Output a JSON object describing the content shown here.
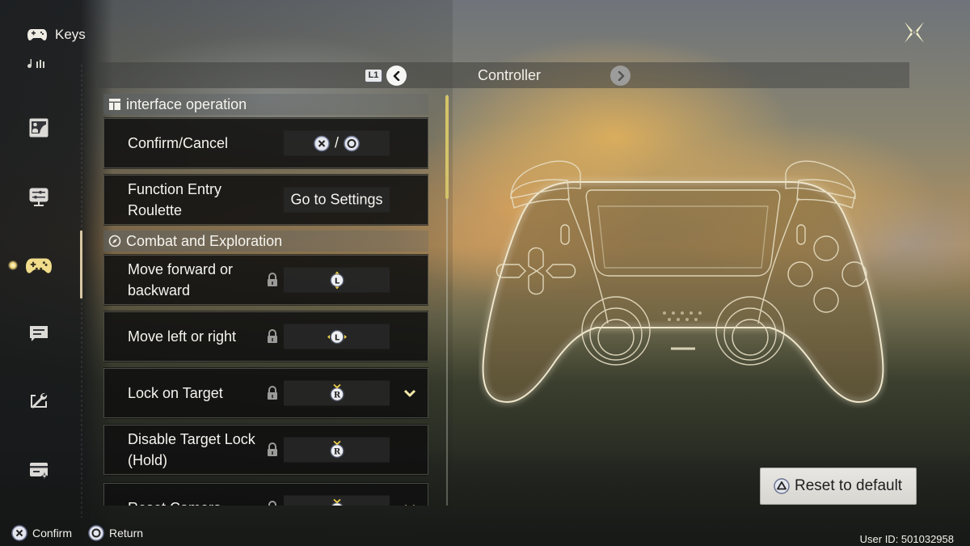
{
  "sidebar": {
    "title": "Keys",
    "title_icon": "gamepad-icon",
    "sub_icon": "music-note-icon",
    "items": [
      {
        "name": "graphics",
        "icon": "picture-icon",
        "active": false
      },
      {
        "name": "display",
        "icon": "monitor-sliders-icon",
        "active": false
      },
      {
        "name": "controls",
        "icon": "gamepad-icon",
        "active": true
      },
      {
        "name": "language",
        "icon": "chat-bubble-icon",
        "active": false
      },
      {
        "name": "other-settings",
        "icon": "wrench-icon",
        "active": false
      },
      {
        "name": "account",
        "icon": "card-icon",
        "active": false
      }
    ]
  },
  "tabbar": {
    "shoulder_hint": "L1",
    "title": "Controller"
  },
  "sections": [
    {
      "title": "interface operation",
      "icon": "layout-icon",
      "rows": [
        {
          "label": "Confirm/Cancel",
          "locked": false,
          "binding_icons": [
            "cross-button-icon",
            "circle-button-icon"
          ],
          "binding_separator": "/"
        },
        {
          "label": "Function Entry Roulette",
          "locked": false,
          "binding_text": "Go to Settings"
        }
      ]
    },
    {
      "title": "Combat and Exploration",
      "icon": "compass-icon",
      "rows": [
        {
          "label": "Move forward or backward",
          "locked": true,
          "binding_icons": [
            "left-stick-vertical-icon"
          ]
        },
        {
          "label": "Move left or right",
          "locked": true,
          "binding_icons": [
            "left-stick-horizontal-icon"
          ]
        },
        {
          "label": "Lock on Target",
          "locked": true,
          "binding_icons": [
            "right-stick-press-icon"
          ],
          "expandable": true
        },
        {
          "label": "Disable Target Lock (Hold)",
          "locked": true,
          "binding_icons": [
            "right-stick-press-icon"
          ]
        },
        {
          "label": "Reset Camera",
          "locked": true,
          "binding_icons": [
            "right-stick-press-icon"
          ],
          "expandable": true
        }
      ]
    }
  ],
  "stick_labels": {
    "left": "L",
    "right": "R"
  },
  "reset_button": {
    "label": "Reset to default",
    "icon": "triangle-button-icon"
  },
  "footer": {
    "confirm_label": "Confirm",
    "return_label": "Return"
  },
  "user_id": "User ID: 501032958",
  "colors": {
    "accent": "#d4c36a",
    "active_icon": "#f0dc8a",
    "row_bg": "#101010",
    "indicator": "#d8c7a4"
  }
}
